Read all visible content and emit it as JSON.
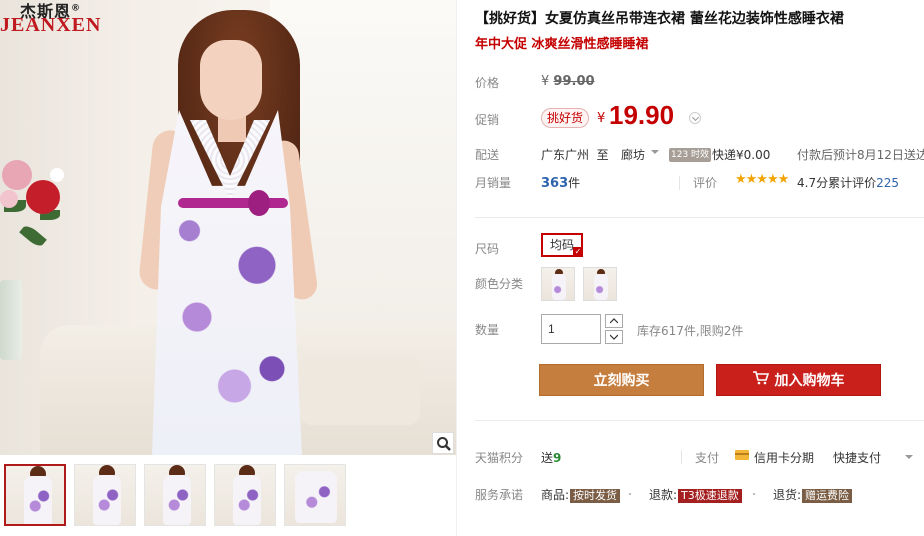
{
  "brand": {
    "logo_cn": "杰斯恩",
    "logo_en": "JEANXEN",
    "logo_mark": "®"
  },
  "product": {
    "title": "【挑好货】女夏仿真丝吊带连衣裙 蕾丝花边装饰性感睡衣裙",
    "subtitle": "年中大促 冰爽丝滑性感睡睡裙"
  },
  "price": {
    "label": "价格",
    "currency": "¥",
    "original": "99.00",
    "promo_label": "促销",
    "promo_badge": "挑好货",
    "promo_price": "19.90"
  },
  "shipping": {
    "label": "配送",
    "from": "广东广州",
    "to_word": "至",
    "to": "廊坊",
    "badge": "123 时效",
    "fee": "快递¥0.00",
    "note": "付款后预计8月12日送达"
  },
  "sales": {
    "label": "月销量",
    "count": "363",
    "unit": "件",
    "rating_label": "评价",
    "stars": "★★★★★",
    "rating_score": "4.7分",
    "rating_text": "累计评价",
    "rating_count": "225"
  },
  "options": {
    "size_label": "尺码",
    "size_value": "均码",
    "color_label": "颜色分类",
    "qty_label": "数量",
    "qty_value": "1",
    "stock_text": "库存617件,限购2件"
  },
  "actions": {
    "buy_now": "立刻购买",
    "add_to_cart": "加入购物车"
  },
  "points": {
    "label": "天猫积分",
    "give": "送",
    "amount": "9"
  },
  "payment": {
    "label": "支付",
    "card": "信用卡分期",
    "quick": "快捷支付"
  },
  "services": {
    "label": "服务承诺",
    "goods_label": "商品:",
    "goods_tag": "按时发货",
    "refund_label": "退款:",
    "refund_tag": "T3极速退款",
    "return_label": "退货:",
    "return_tag": "赠运费险"
  },
  "colors": {
    "accent_red": "#c40000",
    "buy_orange": "#c67e3f",
    "cart_red": "#c9201b",
    "link_blue": "#2e64ad"
  }
}
